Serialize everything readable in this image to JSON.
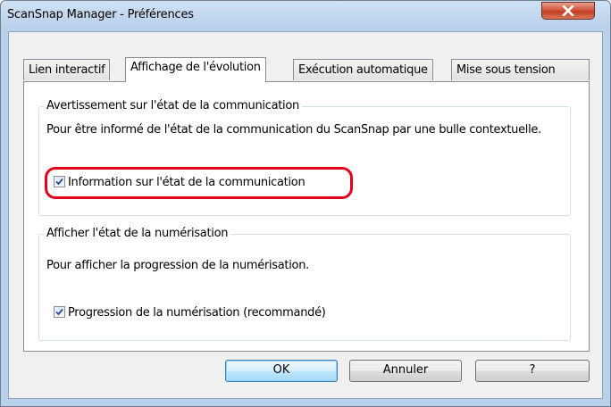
{
  "window": {
    "title": "ScanSnap Manager - Préférences"
  },
  "tabs": [
    {
      "label": "Lien interactif",
      "active": false
    },
    {
      "label": "Affichage de l'évolution",
      "active": true
    },
    {
      "label": "Exécution automatique",
      "active": false
    },
    {
      "label": "Mise sous tension",
      "active": false
    }
  ],
  "groups": {
    "communication": {
      "legend": "Avertissement sur l'état de la communication",
      "description": "Pour être informé de l'état de la communication du ScanSnap par une bulle contextuelle.",
      "checkbox_label": "Information sur l'état de la communication",
      "checked": true
    },
    "scanning": {
      "legend": "Afficher l'état de la numérisation",
      "description": "Pour afficher la progression de la numérisation.",
      "checkbox_label": "Progression de la numérisation (recommandé)",
      "checked": true
    }
  },
  "buttons": {
    "ok": "OK",
    "cancel": "Annuler",
    "help": "?"
  },
  "colors": {
    "highlight": "#e2001a",
    "titlebar": "#b9d1ea",
    "close_button": "#c23b22"
  },
  "icons": {
    "close": "close-icon",
    "check": "checkmark-icon"
  }
}
